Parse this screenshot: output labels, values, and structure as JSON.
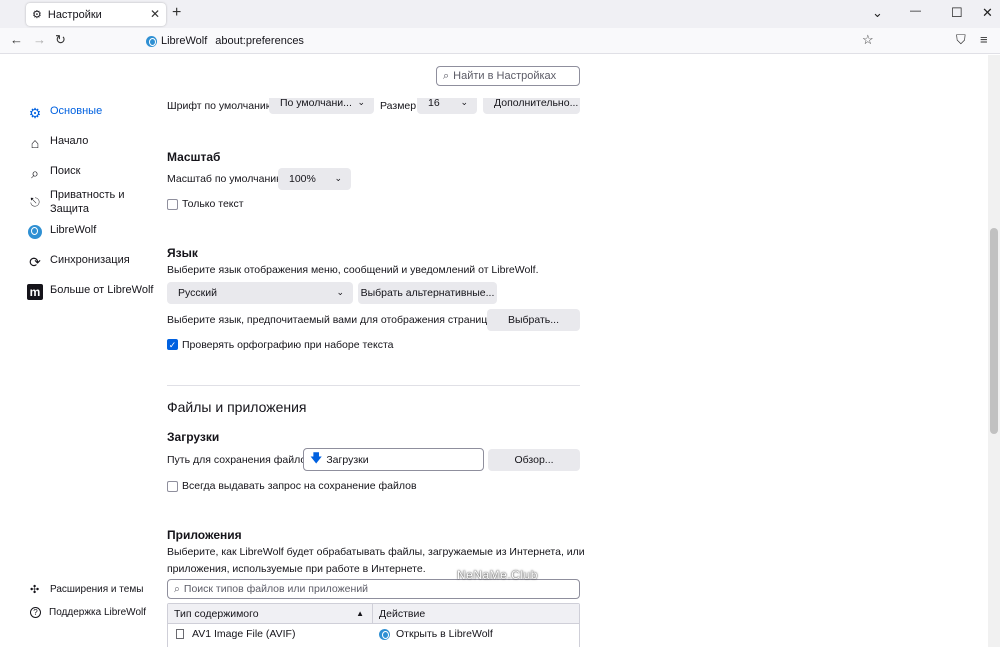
{
  "tab": {
    "title": "Настройки",
    "close": "✕",
    "new_tab": "+"
  },
  "window": {
    "list_tabs": "⌄",
    "minimize": "—",
    "maximize": "☐",
    "close": "✕"
  },
  "nav": {
    "identity": "LibreWolf",
    "url": "about:preferences",
    "back": "←",
    "forward": "→",
    "reload": "↻",
    "bookmark": "☆",
    "shield": "⛉",
    "menu": "≡"
  },
  "search": {
    "placeholder": "Найти в Настройках",
    "icon": "⌕"
  },
  "sidebar": {
    "items": [
      {
        "label": "Основные",
        "icon": "gear-icon",
        "glyph": "⚙"
      },
      {
        "label": "Начало",
        "icon": "home-icon",
        "glyph": "⌂"
      },
      {
        "label": "Поиск",
        "icon": "search-icon",
        "glyph": "⌕"
      },
      {
        "label": "Приватность и\nЗащита",
        "icon": "lock-icon",
        "glyph": "🔒"
      },
      {
        "label": "LibreWolf",
        "icon": "librewolf-icon",
        "glyph": "◔"
      },
      {
        "label": "Синхронизация",
        "icon": "sync-icon",
        "glyph": "⟳"
      },
      {
        "label": "Больше от LibreWolf",
        "icon": "more-from-icon",
        "glyph": "m"
      }
    ],
    "bottom": [
      {
        "label": "Расширения и темы",
        "icon": "puzzle-icon",
        "glyph": "✣"
      },
      {
        "label": "Поддержка LibreWolf",
        "icon": "help-icon",
        "glyph": "?"
      }
    ]
  },
  "fonts": {
    "default_font_label": "Шрифт по умолчанию",
    "default_font_value": "По умолчани...",
    "size_label": "Размер",
    "size_value": "16",
    "advanced_button": "Дополнительно..."
  },
  "zoom": {
    "heading": "Масштаб",
    "default_label": "Масштаб по умолчанию",
    "default_value": "100%",
    "text_only_label": "Только текст"
  },
  "language": {
    "heading": "Язык",
    "description": "Выберите язык отображения меню, сообщений и уведомлений от LibreWolf.",
    "current": "Русский",
    "choose_alternative": "Выбрать альтернативные...",
    "page_language_label": "Выберите язык, предпочитаемый вами для отображения страниц",
    "choose_button": "Выбрать...",
    "spellcheck_label": "Проверять орфографию при наборе текста"
  },
  "files_apps": {
    "heading": "Файлы и приложения"
  },
  "downloads": {
    "heading": "Загрузки",
    "save_path_label": "Путь для сохранения файлов",
    "save_path_value": "Загрузки",
    "browse_button": "Обзор...",
    "always_ask_label": "Всегда выдавать запрос на сохранение файлов"
  },
  "applications": {
    "heading": "Приложения",
    "description_1": "Выберите, как LibreWolf будет обрабатывать файлы, загружаемые из Интернета, или",
    "description_2": "приложения, используемые при работе в Интернете.",
    "search_placeholder": "Поиск типов файлов или приложений",
    "col_content_type": "Тип содержимого",
    "col_action": "Действие",
    "sort_indicator": "▲",
    "rows": [
      {
        "type": "AV1 Image File (AVIF)",
        "action": "Открыть в LibreWolf"
      }
    ]
  },
  "watermark": "NeNaMe.Club",
  "colors": {
    "accent": "#0061e0",
    "toolbar": "#f9f9fb",
    "tabstrip": "#f0f0f4"
  }
}
